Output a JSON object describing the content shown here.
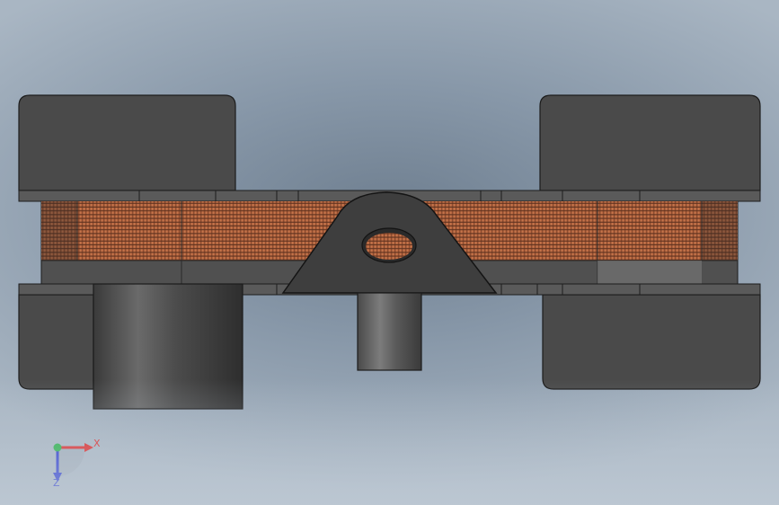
{
  "viewport": {
    "background_top": "#6f7f90",
    "background_bottom": "#a9b6c3"
  },
  "model": {
    "coil_color": "#c8744c",
    "core_color": "#4a4a4a",
    "bracket_color": "#3c3c3c"
  },
  "triad": {
    "x_label": "X",
    "z_label": "Z",
    "x_color": "#e02020",
    "y_color": "#20b040",
    "z_color": "#2030d0"
  }
}
